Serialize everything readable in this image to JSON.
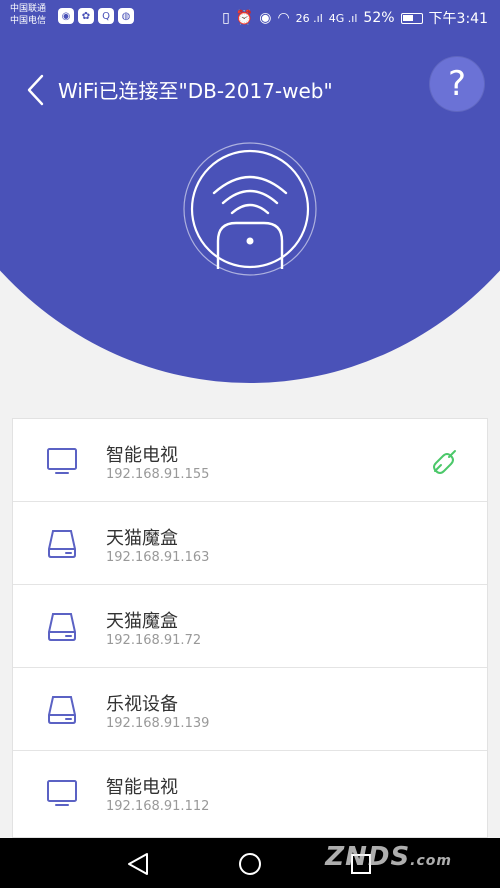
{
  "status_bar": {
    "carrier_1": "中国联通",
    "carrier_2": "中国电信",
    "signal_1": "26 .ıl",
    "signal_2": "4G .ıl",
    "battery": "52%",
    "time": "下午3:41"
  },
  "header": {
    "title": "WiFi已连接至\"DB-2017-web\"",
    "help": "?"
  },
  "devices": [
    {
      "name": "智能电视",
      "ip": "192.168.91.155",
      "type": "tv",
      "linked": true
    },
    {
      "name": "天猫魔盒",
      "ip": "192.168.91.163",
      "type": "box",
      "linked": false
    },
    {
      "name": "天猫魔盒",
      "ip": "192.168.91.72",
      "type": "box",
      "linked": false
    },
    {
      "name": "乐视设备",
      "ip": "192.168.91.139",
      "type": "box",
      "linked": false
    },
    {
      "name": "智能电视",
      "ip": "192.168.91.112",
      "type": "tv",
      "linked": false
    }
  ],
  "watermark": {
    "main": "ZNDS",
    "suffix": ".com"
  },
  "colors": {
    "primary": "#4a52b8",
    "link_green": "#4cc86a",
    "icon_purple": "#5b62c4"
  }
}
